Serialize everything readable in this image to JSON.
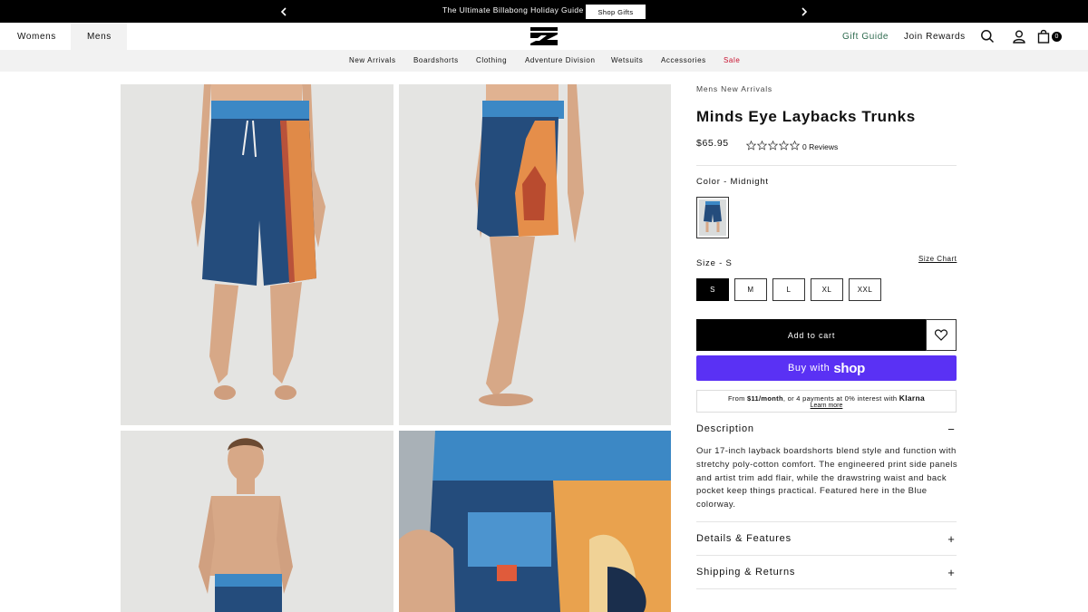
{
  "announcement": {
    "message": "The Ultimate Billabong Holiday Guide",
    "cta": "Shop Gifts",
    "prev_icon": "chevron-left-icon",
    "next_icon": "chevron-right-icon"
  },
  "header": {
    "gender_tabs": [
      "Womens",
      "Mens"
    ],
    "active_gender": "Mens",
    "logo": "billabong-logo",
    "links": {
      "gift_guide": "Gift Guide",
      "join_rewards": "Join Rewards"
    },
    "icons": [
      "search-icon",
      "account-icon",
      "bag-icon"
    ],
    "cart_count": "0"
  },
  "nav": {
    "items": [
      "New Arrivals",
      "Boardshorts",
      "Clothing",
      "Adventure Division",
      "Wetsuits",
      "Accessories",
      "Sale"
    ],
    "sale_color": "#c8102e"
  },
  "gallery": {
    "images": [
      "front-view",
      "side-view",
      "model-full-view",
      "back-pocket-detail"
    ]
  },
  "product": {
    "breadcrumb": "Mens New Arrivals",
    "title": "Minds Eye Laybacks Trunks",
    "price": "$65.95",
    "rating": 0,
    "reviews": "0 Reviews",
    "color_label": "Color - Midnight",
    "size_label": "Size - S",
    "size_chart": "Size Chart",
    "sizes": [
      "S",
      "M",
      "L",
      "XL",
      "XXL"
    ],
    "selected_size": "S",
    "add_to_cart": "Add to cart",
    "wishlist_icon": "heart-icon",
    "shop_pay": {
      "prefix": "Buy with",
      "brand": "shop",
      "color": "#5a31f4"
    },
    "klarna": {
      "from": "From",
      "amount": "$11/month",
      "rest": ", or 4 payments at 0% interest with",
      "brand": "Klarna",
      "learn_more": "Learn more"
    },
    "accordions": [
      {
        "title": "Description",
        "state": "−",
        "text": "Our 17-inch layback boardshorts blend style and function with stretchy poly-cotton comfort. The engineered print side panels and artist trim add flair, while the drawstring waist and back pocket keep things practical. Featured here in the Blue colorway."
      },
      {
        "title": "Details & Features",
        "state": "+"
      },
      {
        "title": "Shipping & Returns",
        "state": "+"
      }
    ]
  }
}
